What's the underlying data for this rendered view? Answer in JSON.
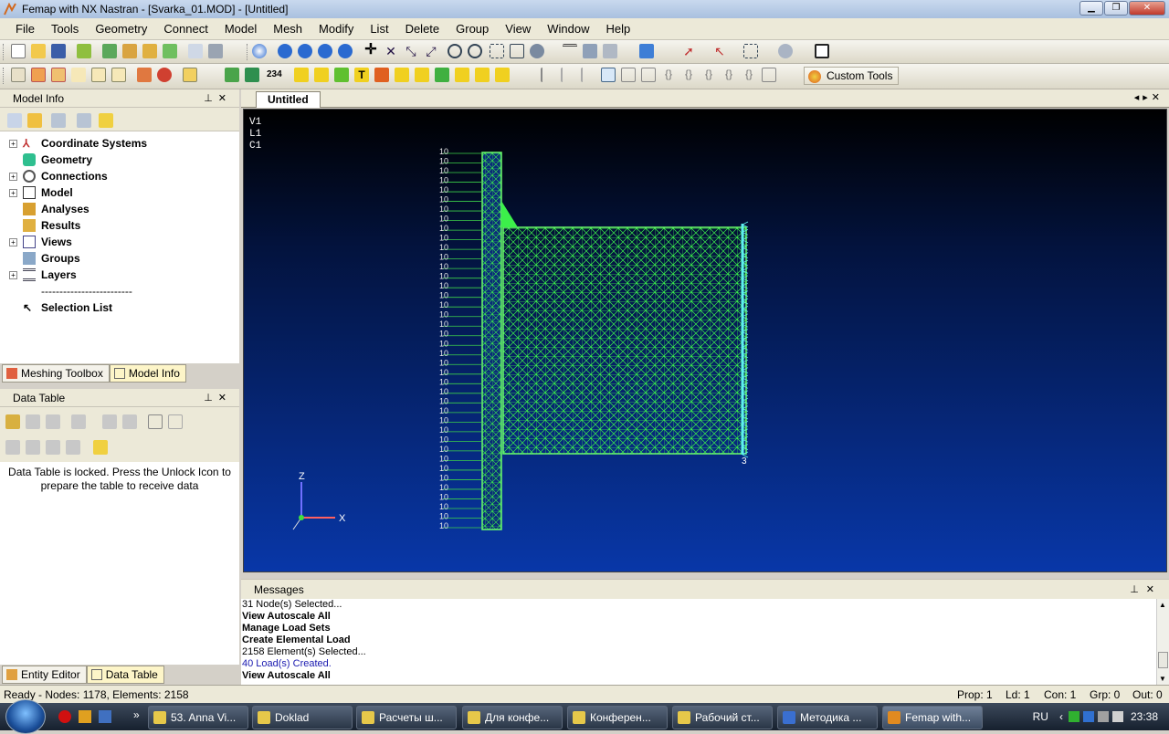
{
  "window": {
    "title": "Femap with NX Nastran - [Svarka_01.MOD] - [Untitled]"
  },
  "menu": [
    "File",
    "Tools",
    "Geometry",
    "Connect",
    "Model",
    "Mesh",
    "Modify",
    "List",
    "Delete",
    "Group",
    "View",
    "Window",
    "Help"
  ],
  "toolbar": {
    "custom_tools": "Custom Tools",
    "load_value": "234"
  },
  "model_info": {
    "title": "Model Info",
    "items": [
      {
        "label": "Coordinate Systems",
        "expandable": true
      },
      {
        "label": "Geometry",
        "expandable": false
      },
      {
        "label": "Connections",
        "expandable": true
      },
      {
        "label": "Model",
        "expandable": true
      },
      {
        "label": "Analyses",
        "expandable": false
      },
      {
        "label": "Results",
        "expandable": false
      },
      {
        "label": "Views",
        "expandable": true
      },
      {
        "label": "Groups",
        "expandable": false
      },
      {
        "label": "Layers",
        "expandable": true
      },
      {
        "label": "-------------------------",
        "expandable": false
      },
      {
        "label": "Selection List",
        "expandable": false
      }
    ],
    "tabs": [
      "Meshing Toolbox",
      "Model Info"
    ]
  },
  "data_table": {
    "title": "Data Table",
    "locked_message": "Data Table is locked. Press the Unlock Icon to prepare the table to receive data",
    "tabs": [
      "Entity Editor",
      "Data Table"
    ]
  },
  "view": {
    "tab": "Untitled",
    "labels": [
      "V1",
      "L1",
      "C1"
    ],
    "load_label": "10",
    "node_label": "3",
    "axis_z": "Z",
    "axis_x": "X"
  },
  "messages": {
    "title": "Messages",
    "lines": [
      {
        "text": "31 Node(s) Selected...",
        "style": ""
      },
      {
        "text": "View Autoscale All",
        "style": "b"
      },
      {
        "text": "Manage Load Sets",
        "style": "b"
      },
      {
        "text": "Create Elemental Load",
        "style": "b"
      },
      {
        "text": "2158 Element(s) Selected...",
        "style": ""
      },
      {
        "text": "40 Load(s) Created.",
        "style": "blue"
      },
      {
        "text": "View Autoscale All",
        "style": "b"
      }
    ]
  },
  "status": {
    "left": "Ready - Nodes: 1178,  Elements: 2158",
    "prop": "Prop: 1",
    "ld": "Ld: 1",
    "con": "Con: 1",
    "grp": "Grp: 0",
    "out": "Out: 0"
  },
  "taskbar": {
    "tasks": [
      "53. Anna Vi...",
      "Doklad",
      "Расчеты ш...",
      "Для конфе...",
      "Конферен...",
      "Рабочий ст...",
      "Методика ...",
      "Femap with..."
    ],
    "lang": "RU",
    "time": "23:38"
  }
}
